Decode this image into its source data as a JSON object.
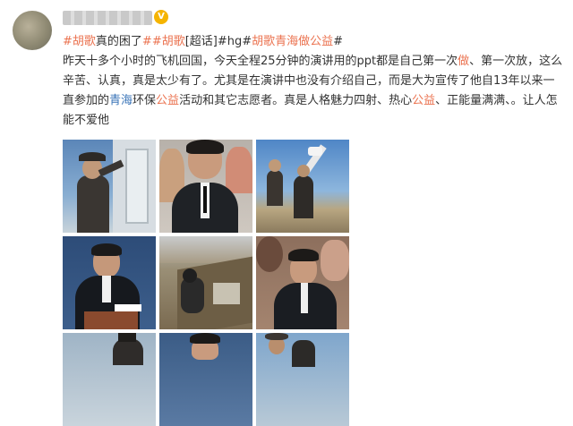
{
  "post": {
    "tags_line": [
      {
        "text": "#胡歌",
        "type": "tag"
      },
      {
        "text": "真的困了",
        "type": "plain"
      },
      {
        "text": "##胡歌",
        "type": "tag"
      },
      {
        "text": "[超话]",
        "type": "plain"
      },
      {
        "text": "#hg#",
        "type": "plain"
      },
      {
        "text": "胡歌青海做公益",
        "type": "tag"
      },
      {
        "text": "#",
        "type": "plain"
      }
    ],
    "body": [
      {
        "text": "昨天十多个小时的飞机回国，今天全程25分钟的演讲用的ppt都是自己第一次",
        "type": "plain"
      },
      {
        "text": "做",
        "type": "hl"
      },
      {
        "text": "、第一次放，这么辛苦、认真，真是太少有了。尤其是在演讲中也没有介绍自己，而是大为宣传了他自13年以来一直参加的",
        "type": "plain"
      },
      {
        "text": "青海",
        "type": "link"
      },
      {
        "text": "环保",
        "type": "plain"
      },
      {
        "text": "公益",
        "type": "hl"
      },
      {
        "text": "活动和其它志愿者。真是人格魅力四射、热心",
        "type": "plain"
      },
      {
        "text": "公益",
        "type": "hl"
      },
      {
        "text": "、正能量满满、。让人怎能不爱他",
        "type": "plain"
      }
    ]
  },
  "photos": [
    {
      "label": "photo-man-hanging-sign"
    },
    {
      "label": "photo-man-in-suit-crowd"
    },
    {
      "label": "photo-outdoor-telescope"
    },
    {
      "label": "photo-speaker-at-podium"
    },
    {
      "label": "photo-hillside-sitting"
    },
    {
      "label": "photo-audience-close-up"
    },
    {
      "label": "photo-sky-man-partial"
    },
    {
      "label": "photo-portrait-partial"
    },
    {
      "label": "photo-outdoor-group-partial"
    }
  ],
  "colors": {
    "tag": "#eb7350",
    "link": "#3b75b8",
    "text": "#333333",
    "badge": "#f5b400"
  }
}
